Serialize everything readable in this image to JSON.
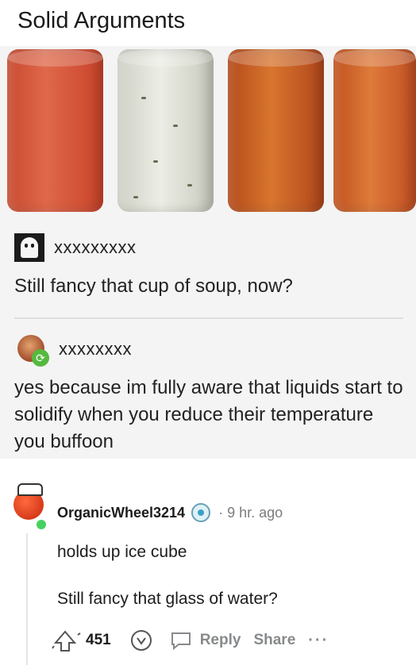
{
  "post": {
    "title": "Solid Arguments",
    "tumblr": {
      "op_handle": "xxxxxxxxx",
      "op_text": "Still fancy that cup of soup, now?",
      "reply_handle": "xxxxxxxx",
      "reply_text": "yes because im fully aware that liquids start to solidify when you reduce their temperature you buffoon"
    }
  },
  "comment": {
    "username": "OrganicWheel3214",
    "time": "· 9 hr. ago",
    "line1": "holds up ice cube",
    "line2": "Still fancy that glass of water?",
    "score": "451",
    "reply_label": "Reply",
    "share_label": "Share",
    "more_label": "···"
  }
}
